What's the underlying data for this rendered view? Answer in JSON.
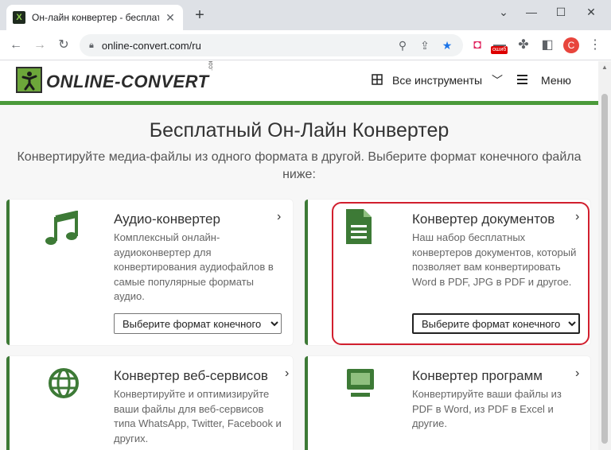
{
  "browser": {
    "tab_title": "Он-лайн конвертер - бесплатнo",
    "tab_favicon": "X",
    "new_tab": "+",
    "url": "online-convert.com/ru",
    "avatar_letter": "C",
    "ext_badge": "ошиб",
    "win_minimize": "—",
    "win_maximize": "☐",
    "win_close": "✕",
    "win_menu": "⌄"
  },
  "site": {
    "logo_text": "ONLINE-CONVERT",
    "logo_com": ".com",
    "tools_label": "Все инструменты",
    "menu_label": "Меню"
  },
  "hero": {
    "title": "Бесплатный Он-Лайн Конвертер",
    "subtitle": "Конвертируйте медиа-файлы из одного формата в другой. Выберите формат конечного файла ниже:"
  },
  "cards": [
    {
      "title": "Аудио-конвертер",
      "desc": "Комплексный онлайн-аудиоконвертер для конвертирования аудиофайлов в самые популярные форматы аудио.",
      "select": "Выберите формат конечного",
      "icon": "music-note-icon"
    },
    {
      "title": "Конвертер документов",
      "desc": "Наш набор бесплатных конвертеров документов, который позволяет вам конвертировать Word в PDF, JPG в PDF и другое.",
      "select": "Выберите формат конечного",
      "icon": "document-icon"
    },
    {
      "title": "Конвертер веб-сервисов",
      "desc": "Конвертируйте и оптимизируйте ваши файлы для веб-сервисов типа WhatsApp, Twitter, Facebook и других.",
      "icon": "globe-icon"
    },
    {
      "title": "Конвертер программ",
      "desc": "Конвертируйте ваши файлы из PDF в Word, из PDF в Excel и другие.",
      "icon": "monitor-icon"
    }
  ],
  "colors": {
    "brand_green": "#3d7a36",
    "highlight_red": "#d11f2e"
  }
}
